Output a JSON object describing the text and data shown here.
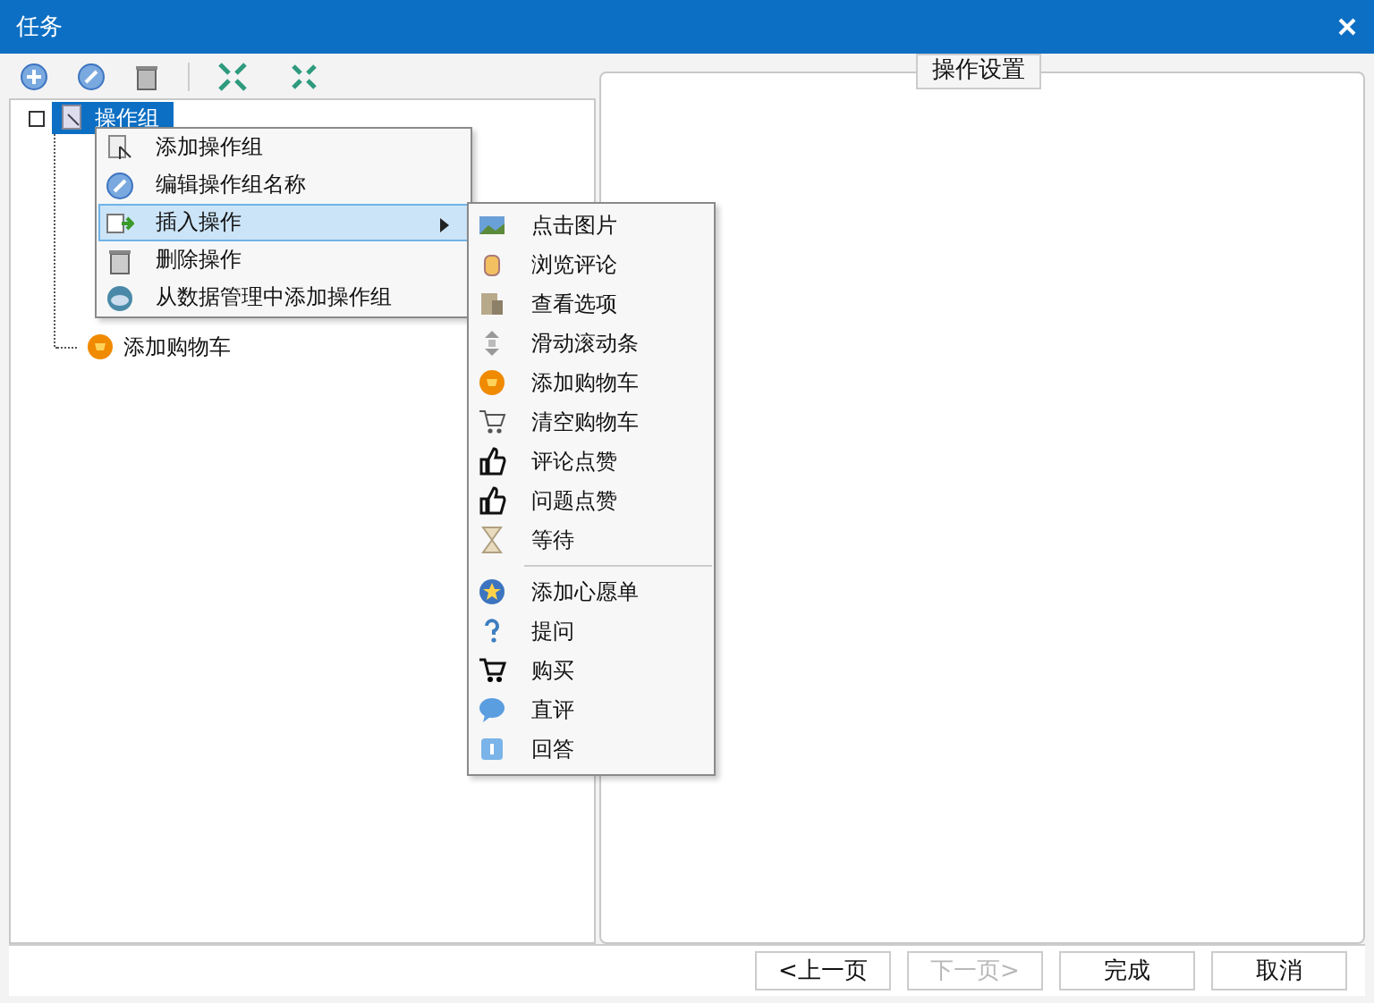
{
  "window": {
    "title": "任务"
  },
  "tree": {
    "label": "操作组",
    "selected": true,
    "expanded": true,
    "children": [
      {
        "label": "添加购物车"
      }
    ]
  },
  "context_menu": [
    {
      "label": "添加操作组",
      "selected": false,
      "has_submenu": false
    },
    {
      "label": "编辑操作组名称",
      "selected": false,
      "has_submenu": false
    },
    {
      "label": "插入操作",
      "selected": true,
      "has_submenu": true
    },
    {
      "label": "删除操作",
      "selected": false,
      "has_submenu": false
    },
    {
      "label": "从数据管理中添加操作组",
      "selected": false,
      "has_submenu": false
    }
  ],
  "submenu_groups": [
    [
      {
        "label": "点击图片"
      },
      {
        "label": "浏览评论"
      },
      {
        "label": "查看选项"
      },
      {
        "label": "滑动滚动条"
      },
      {
        "label": "添加购物车"
      },
      {
        "label": "清空购物车"
      },
      {
        "label": "评论点赞"
      },
      {
        "label": "问题点赞"
      },
      {
        "label": "等待"
      }
    ],
    [
      {
        "label": "添加心愿单"
      },
      {
        "label": "提问"
      },
      {
        "label": "购买"
      },
      {
        "label": "直评"
      },
      {
        "label": "回答"
      }
    ]
  ],
  "settings_panel": {
    "title": "操作设置"
  },
  "buttons": [
    {
      "label": "<上一页",
      "disabled": false
    },
    {
      "label": "下一页>",
      "disabled": true
    },
    {
      "label": "完成",
      "disabled": false
    },
    {
      "label": "取消",
      "disabled": false
    }
  ]
}
